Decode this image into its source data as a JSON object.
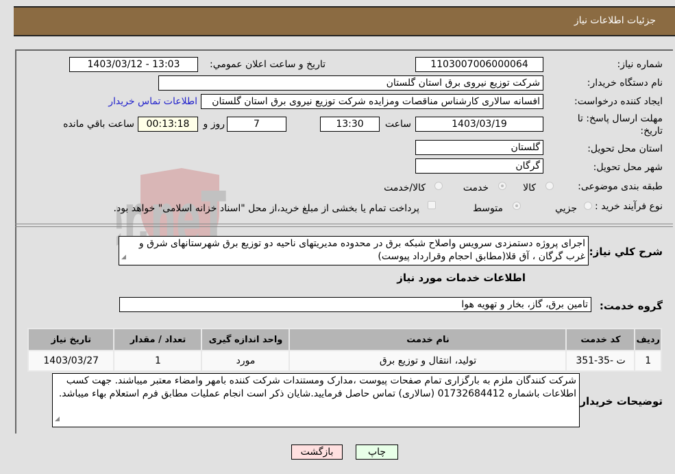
{
  "header": {
    "title": "جزئیات اطلاعات نیاز"
  },
  "fields": {
    "need_number": {
      "label": "شماره نیاز:",
      "value": "1103007006000064"
    },
    "announce_datetime": {
      "label": "تاریخ و ساعت اعلان عمومي:",
      "value": "1403/03/12 - 13:03"
    },
    "buyer_org": {
      "label": "نام دستگاه خریدار:",
      "value": "شرکت توزیع نیروی برق استان گلستان"
    },
    "requester": {
      "label": "ایجاد کننده درخواست:",
      "value": "افسانه سالاری کارشناس مناقصات ومزایده شرکت توزیع نیروی برق استان گلستان",
      "contact_link": "اطلاعات تماس خریدار"
    },
    "deadline": {
      "label": "مهلت ارسال پاسخ: تا تاریخ:",
      "date": "1403/03/19",
      "time_label": "ساعت",
      "time": "13:30",
      "days": "7",
      "days_label": "روز و",
      "remaining": "00:13:18",
      "remaining_label": "ساعت باقي مانده"
    },
    "province": {
      "label": "استان محل تحویل:",
      "value": "گلستان"
    },
    "city": {
      "label": "شهر محل تحویل:",
      "value": "گرگان"
    },
    "category": {
      "label": "طبقه بندی موضوعی:",
      "options": [
        "کالا",
        "خدمت",
        "کالا/خدمت"
      ],
      "selected": "خدمت"
    },
    "purchase_type": {
      "label": "نوع فرآیند خرید :",
      "options": [
        "جزيي",
        "متوسط"
      ],
      "selected": "متوسط",
      "treasury_note": "پرداخت تمام یا بخشی از مبلغ خرید،از محل \"اسناد خزانه اسلامی\" خواهد بود."
    }
  },
  "description": {
    "label": "شرح کلي نیاز:",
    "value": "اجرای پروژه دستمزدی سرویس واصلاح شبکه برق در محدوده  مدیریتهای ناحیه دو  توزیع  برق شهرستانهای شرق و غرب گرگان ، آق قلا(مطابق احجام وقرارداد پیوست)"
  },
  "services_section": {
    "title": "اطلاعات خدمات مورد نیاز",
    "group_label": "گروه خدمت:",
    "group_value": "تامین برق، گاز، بخار و تهویه هوا",
    "table": {
      "columns": [
        "ردیف",
        "کد خدمت",
        "نام خدمت",
        "واحد اندازه گیری",
        "تعداد / مقدار",
        "تاریخ نیاز"
      ],
      "rows": [
        [
          "1",
          "ت -35-351",
          "تولید، انتقال و توزیع برق",
          "مورد",
          "1",
          "1403/03/27"
        ]
      ]
    }
  },
  "buyer_notes": {
    "label": "توضیحات خریدار:",
    "value": "شرکت کنندگان ملزم به بارگزاری تمام صفحات پیوست ،مدارک ومستندات شرکت کننده بامهر وامضاء معتبر میباشند. جهت کسب اطلاعات باشماره 01732684412 (سالاری) تماس حاصل فرمایید.شایان ذکر است انجام عملیات مطابق فرم استعلام بهاء میباشد."
  },
  "buttons": {
    "print": "چاپ",
    "back": "بازگشت"
  },
  "watermark": {
    "text": "AriaTender.net"
  },
  "colors": {
    "header_bg": "#8b6b42",
    "back_btn": "#ffe0e0",
    "print_btn": "#e8ffe8",
    "remaining_bg": "#ffffe8",
    "link": "#2222cc"
  }
}
